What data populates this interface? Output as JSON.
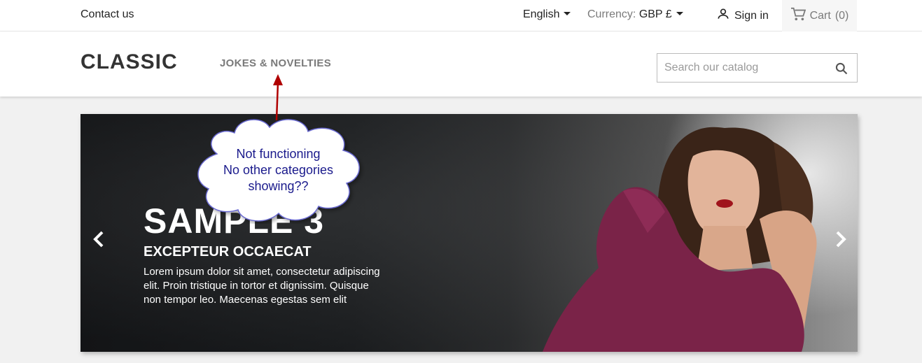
{
  "topbar": {
    "contact_label": "Contact us",
    "language_label": "English",
    "currency_prefix": "Currency:",
    "currency_value": "GBP £",
    "signin_label": "Sign in",
    "cart_label": "Cart",
    "cart_count": "(0)"
  },
  "header": {
    "logo_text": "CLASSIC",
    "menu_items": [
      {
        "label": "JOKES & NOVELTIES"
      }
    ],
    "search": {
      "placeholder": "Search our catalog"
    }
  },
  "slider": {
    "title": "SAMPLE 3",
    "subtitle": "EXCEPTEUR OCCAECAT",
    "text": "Lorem ipsum dolor sit amet, consectetur adipiscing elit. Proin tristique in tortor et dignissim. Quisque non tempor leo. Maecenas egestas sem elit"
  },
  "annotation": {
    "line1": "Not functioning",
    "line2": "No other categories",
    "line3": "showing??"
  },
  "colors": {
    "annotation_text": "#1a1a8c",
    "annotation_arrow": "#b00000",
    "cloud_border": "#6a6ad0"
  }
}
